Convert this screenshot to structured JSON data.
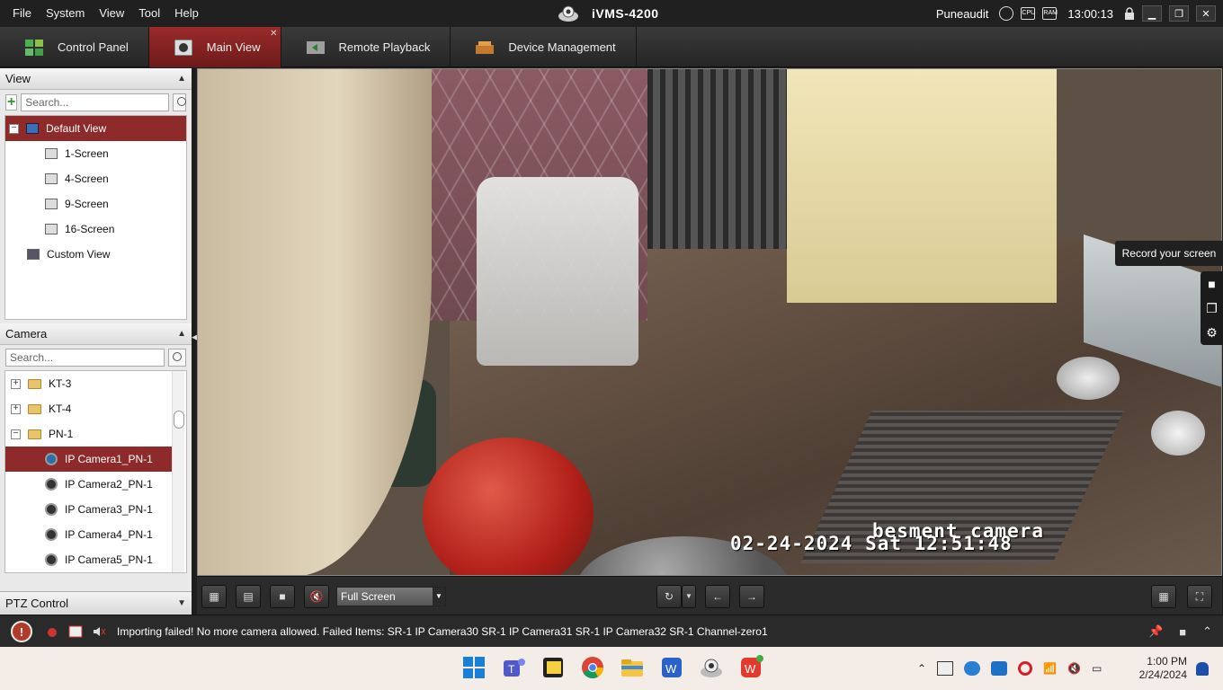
{
  "titlebar": {
    "menu": [
      "File",
      "System",
      "View",
      "Tool",
      "Help"
    ],
    "app_title": "iVMS-4200",
    "user": "Puneaudit",
    "time": "13:00:13",
    "controls": [
      "minimize",
      "restore",
      "close"
    ]
  },
  "tabs": [
    {
      "label": "Control Panel",
      "icon": "control-panel-icon"
    },
    {
      "label": "Main View",
      "icon": "main-view-icon",
      "active": true
    },
    {
      "label": "Remote Playback",
      "icon": "playback-icon"
    },
    {
      "label": "Device Management",
      "icon": "device-icon"
    }
  ],
  "view_panel": {
    "title": "View",
    "search_placeholder": "Search...",
    "items": [
      {
        "label": "Default View",
        "selected": true
      },
      {
        "label": "1-Screen"
      },
      {
        "label": "4-Screen"
      },
      {
        "label": "9-Screen"
      },
      {
        "label": "16-Screen"
      },
      {
        "label": "Custom View"
      }
    ]
  },
  "camera_panel": {
    "title": "Camera",
    "search_placeholder": "Search...",
    "groups": [
      {
        "label": "KT-3",
        "expander": "+"
      },
      {
        "label": "KT-4",
        "expander": "+"
      },
      {
        "label": "PN-1",
        "expander": "−"
      }
    ],
    "cameras": [
      {
        "label": "IP Camera1_PN-1",
        "selected": true
      },
      {
        "label": "IP Camera2_PN-1"
      },
      {
        "label": "IP Camera3_PN-1"
      },
      {
        "label": "IP Camera4_PN-1"
      },
      {
        "label": "IP Camera5_PN-1"
      }
    ]
  },
  "ptz": {
    "title": "PTZ Control"
  },
  "video": {
    "osd_name": "besment camera",
    "osd_time": "02-24-2024 Sat 12:51:48"
  },
  "record_widget": {
    "tooltip": "Record your screen",
    "icons": [
      "video-camera-icon",
      "screenshot-icon",
      "settings-gear-icon"
    ]
  },
  "video_toolbar": {
    "layout_select": "Full Screen"
  },
  "status_bar": {
    "message": "Importing failed! No more camera allowed. Failed Items: SR-1 IP Camera30 SR-1 IP Camera31 SR-1 IP Camera32 SR-1 Channel-zero1"
  },
  "taskbar": {
    "apps": [
      "start",
      "teams",
      "sticky-notes",
      "chrome",
      "file-explorer",
      "wps-writer",
      "ivms",
      "wps-office"
    ],
    "time": "1:00 PM",
    "date": "2/24/2024"
  },
  "colors": {
    "accent_red": "#8e2a2a",
    "titlebar": "#202020",
    "taskbar": "#f3ece7"
  }
}
